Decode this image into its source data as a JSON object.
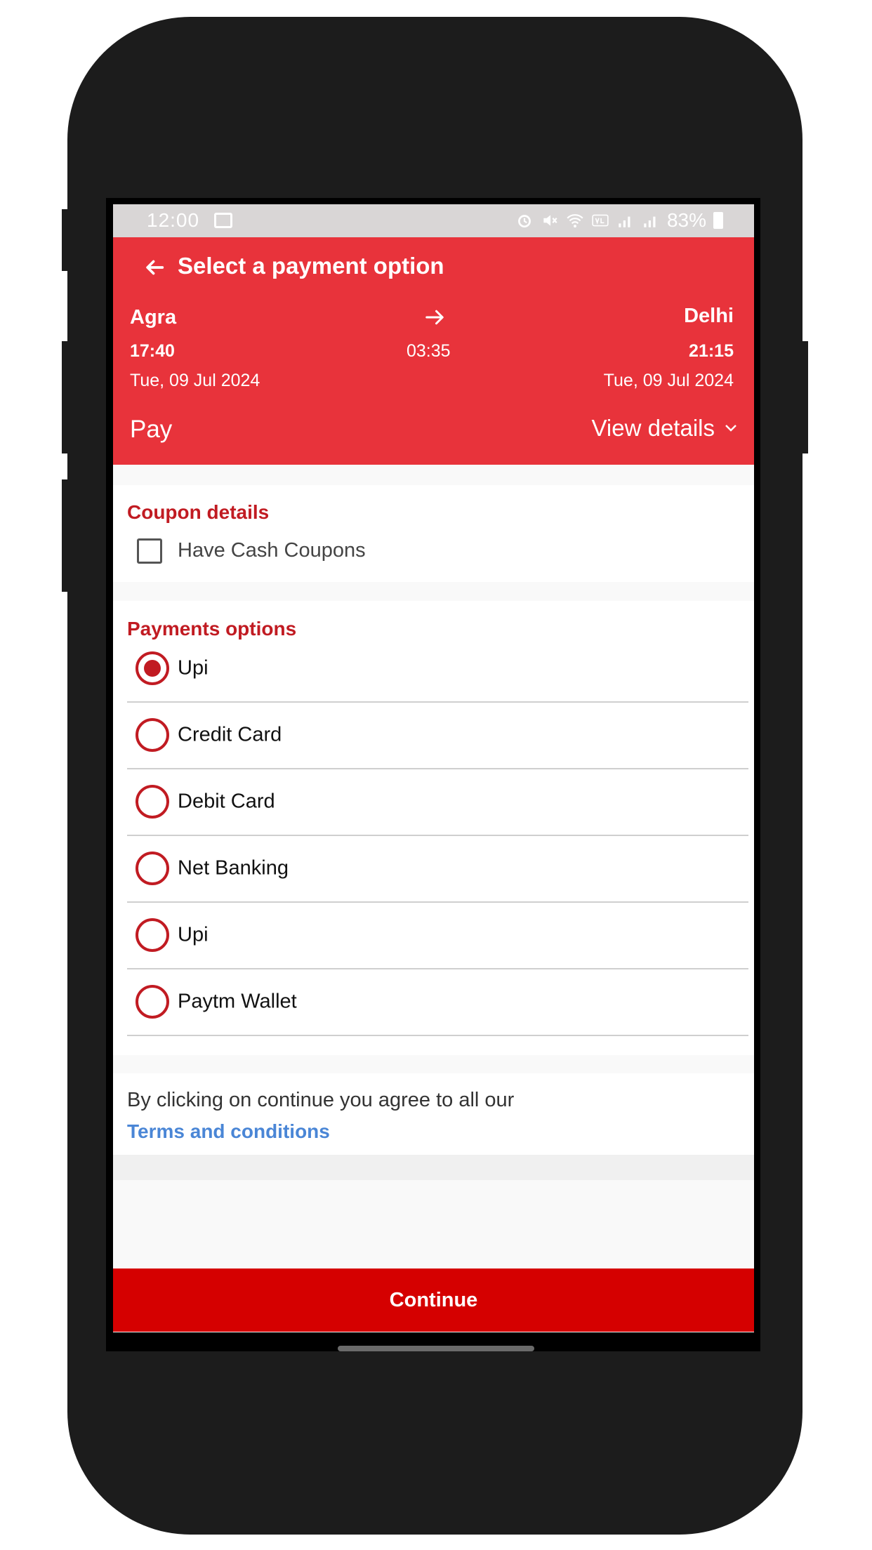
{
  "status_bar": {
    "time": "12:00",
    "battery": "83%",
    "icons": [
      "image-icon",
      "alarm-icon",
      "mute-icon",
      "wifi-icon",
      "volte-icon",
      "signal-icon",
      "signal-icon",
      "battery-icon"
    ]
  },
  "header": {
    "title": "Select a payment option",
    "from": {
      "city": "Agra",
      "time": "17:40",
      "date": "Tue, 09 Jul 2024"
    },
    "to": {
      "city": "Delhi",
      "time": "21:15",
      "date": "Tue, 09 Jul 2024"
    },
    "duration": "03:35",
    "pay_label": "Pay",
    "view_details_label": "View details"
  },
  "coupon": {
    "title": "Coupon details",
    "checkbox_label": "Have Cash Coupons",
    "checked": false
  },
  "payments": {
    "title": "Payments options",
    "options": [
      {
        "label": "Upi",
        "selected": true
      },
      {
        "label": "Credit Card",
        "selected": false
      },
      {
        "label": "Debit Card",
        "selected": false
      },
      {
        "label": "Net Banking",
        "selected": false
      },
      {
        "label": "Upi",
        "selected": false
      },
      {
        "label": "Paytm Wallet",
        "selected": false
      }
    ]
  },
  "terms": {
    "text": "By clicking on continue you agree to all our",
    "link": "Terms and conditions"
  },
  "continue_label": "Continue",
  "colors": {
    "header_red": "#e8333b",
    "accent_red": "#c11b22",
    "button_red": "#d50000",
    "link_blue": "#4a86d6"
  }
}
